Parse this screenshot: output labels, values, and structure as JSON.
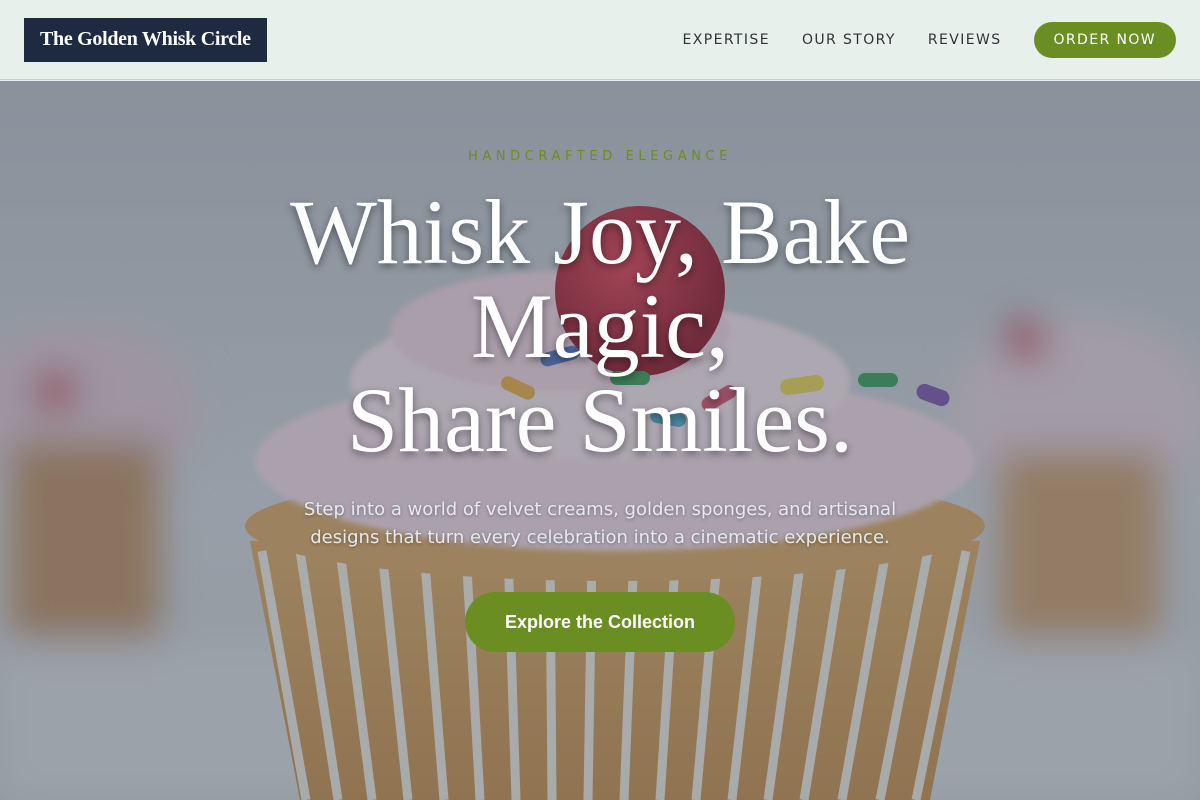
{
  "header": {
    "logo_text": "The Golden Whisk Circle",
    "nav": [
      {
        "label": "EXPERTISE"
      },
      {
        "label": "OUR STORY"
      },
      {
        "label": "REVIEWS"
      }
    ],
    "order_button": "ORDER NOW"
  },
  "hero": {
    "eyebrow": "HANDCRAFTED ELEGANCE",
    "headline_lines": [
      "Whisk Joy, Bake",
      "Magic,",
      "Share Smiles."
    ],
    "subtext": "Step into a world of velvet creams, golden sponges, and artisanal designs that turn every celebration into a cinematic experience.",
    "cta_label": "Explore the Collection",
    "background_image": "cupcake-with-pink-frosting-and-cherry"
  },
  "colors": {
    "accent_green": "#6b8e23",
    "logo_navy": "#1e2a3f",
    "header_bg": "#e8f0ec"
  }
}
